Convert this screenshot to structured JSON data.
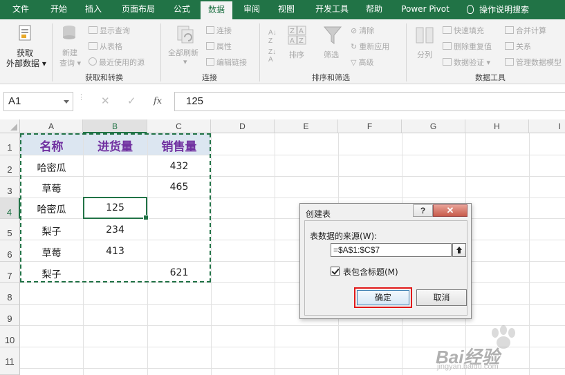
{
  "ribbon_tabs": [
    {
      "label": "文件",
      "active": false
    },
    {
      "label": "开始",
      "active": false
    },
    {
      "label": "插入",
      "active": false
    },
    {
      "label": "页面布局",
      "active": false
    },
    {
      "label": "公式",
      "active": false
    },
    {
      "label": "数据",
      "active": true
    },
    {
      "label": "审阅",
      "active": false
    },
    {
      "label": "视图",
      "active": false
    },
    {
      "label": "开发工具",
      "active": false
    },
    {
      "label": "帮助",
      "active": false
    },
    {
      "label": "Power Pivot",
      "active": false
    }
  ],
  "tell_me": "操作说明搜索",
  "ribbon": {
    "get_external": {
      "line1": "获取",
      "line2": "外部数据"
    },
    "new_query": {
      "line1": "新建",
      "line2": "查询"
    },
    "show_queries": "显示查询",
    "from_table": "从表格",
    "recent_sources": "最近使用的源",
    "group_get_transform": "获取和转换",
    "refresh_all": "全部刷新",
    "connections": "连接",
    "properties": "属性",
    "edit_links": "编辑链接",
    "group_connections": "连接",
    "sort": "排序",
    "filter": "筛选",
    "clear": "清除",
    "reapply": "重新应用",
    "advanced": "高级",
    "group_sort_filter": "排序和筛选",
    "text_to_columns": "分列",
    "flash_fill": "快速填充",
    "remove_duplicates": "删除重复值",
    "data_validation": "数据验证",
    "consolidate": "合并计算",
    "relationships": "关系",
    "manage_data_model": "管理数据模型",
    "group_data_tools": "数据工具"
  },
  "formula_bar": {
    "name_box": "A1",
    "fx": "fx",
    "cancel": "✕",
    "enter": "✓",
    "value": "125"
  },
  "columns": [
    "A",
    "B",
    "C",
    "D",
    "E",
    "F",
    "G",
    "H",
    "I"
  ],
  "rows": [
    "1",
    "2",
    "3",
    "4",
    "5",
    "6",
    "7",
    "8",
    "9",
    "10",
    "11"
  ],
  "table": {
    "headers": [
      "名称",
      "进货量",
      "销售量"
    ],
    "rows": [
      [
        "哈密瓜",
        "",
        "432"
      ],
      [
        "草莓",
        "",
        "465"
      ],
      [
        "哈密瓜",
        "125",
        ""
      ],
      [
        "梨子",
        "234",
        ""
      ],
      [
        "草莓",
        "413",
        ""
      ],
      [
        "梨子",
        "",
        "621"
      ]
    ]
  },
  "dialog": {
    "title": "创建表",
    "help": "?",
    "close": "✕",
    "source_label": "表数据的来源(W):",
    "range": "=$A$1:$C$7",
    "has_headers_label": "表包含标题(M)",
    "has_headers": true,
    "ok": "确定",
    "cancel": "取消"
  },
  "watermark": {
    "text": "Bai经验",
    "sub": "jingyan.baidu.com"
  },
  "colors": {
    "accent": "#217346",
    "header_text": "#7030a0",
    "header_fill": "#dce6f1",
    "highlight": "#e21919"
  }
}
